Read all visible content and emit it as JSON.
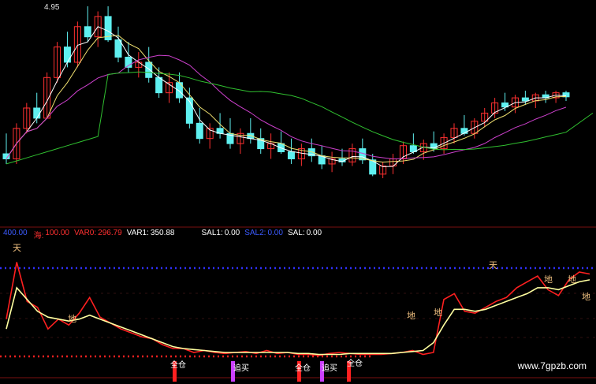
{
  "window": {
    "title": ""
  },
  "price_label": "4.95",
  "indicators": [
    {
      "name": "400.00",
      "value": "",
      "color": "#3b5bff"
    },
    {
      "name": "海:",
      "value": "100.00",
      "color": "#ff3030"
    },
    {
      "name": "VAR0:",
      "value": "296.79",
      "color": "#ff3030"
    },
    {
      "name": "VAR1:",
      "value": "350.88",
      "color": "#ffffff"
    },
    {
      "name": "SAL1:",
      "value": "0.00",
      "color": "#ffffff"
    },
    {
      "name": "SAL2:",
      "value": "0.00",
      "color": "#3b5bff"
    },
    {
      "name": "SAL:",
      "value": "0.00",
      "color": "#ffffff"
    }
  ],
  "signals": {
    "sky": "天",
    "ground": "地",
    "full": "全仓",
    "chase": "追买"
  },
  "watermark": "www.7gpzb.com",
  "colors": {
    "background": "#000000",
    "up_candle": "#ff3030",
    "down_candle": "#5ff0f0",
    "ma_short": "#ffffff",
    "ma_mid": "#f0e070",
    "ma_long": "#cc40cc",
    "ma_longer": "#30c030",
    "osc_red": "#ff2020",
    "osc_yellow": "#ffffa0",
    "level_blue": "#3030ff",
    "level_red": "#ff2020"
  },
  "chart_data": {
    "type": "candlestick",
    "candles": [
      [
        3.5,
        3.7,
        3.4,
        3.45
      ],
      [
        3.45,
        3.8,
        3.4,
        3.75
      ],
      [
        3.75,
        4.0,
        3.7,
        3.95
      ],
      [
        3.95,
        4.1,
        3.8,
        3.85
      ],
      [
        3.85,
        4.3,
        3.85,
        4.25
      ],
      [
        4.25,
        4.6,
        4.2,
        4.55
      ],
      [
        4.55,
        4.7,
        4.35,
        4.4
      ],
      [
        4.4,
        4.8,
        4.35,
        4.75
      ],
      [
        4.75,
        4.95,
        4.6,
        4.65
      ],
      [
        4.65,
        4.9,
        4.55,
        4.85
      ],
      [
        4.85,
        4.95,
        4.6,
        4.62
      ],
      [
        4.62,
        4.75,
        4.4,
        4.45
      ],
      [
        4.45,
        4.6,
        4.3,
        4.35
      ],
      [
        4.35,
        4.5,
        4.25,
        4.4
      ],
      [
        4.4,
        4.55,
        4.2,
        4.25
      ],
      [
        4.25,
        4.35,
        4.05,
        4.1
      ],
      [
        4.1,
        4.3,
        4.0,
        4.2
      ],
      [
        4.2,
        4.3,
        4.0,
        4.05
      ],
      [
        4.05,
        4.15,
        3.75,
        3.8
      ],
      [
        3.8,
        3.95,
        3.6,
        3.65
      ],
      [
        3.65,
        3.8,
        3.55,
        3.75
      ],
      [
        3.75,
        3.9,
        3.65,
        3.7
      ],
      [
        3.7,
        3.85,
        3.55,
        3.6
      ],
      [
        3.6,
        3.75,
        3.5,
        3.7
      ],
      [
        3.7,
        3.85,
        3.6,
        3.65
      ],
      [
        3.65,
        3.75,
        3.5,
        3.55
      ],
      [
        3.55,
        3.7,
        3.45,
        3.6
      ],
      [
        3.6,
        3.72,
        3.5,
        3.52
      ],
      [
        3.52,
        3.65,
        3.4,
        3.45
      ],
      [
        3.45,
        3.6,
        3.38,
        3.55
      ],
      [
        3.55,
        3.65,
        3.42,
        3.48
      ],
      [
        3.48,
        3.58,
        3.35,
        3.4
      ],
      [
        3.4,
        3.52,
        3.32,
        3.45
      ],
      [
        3.45,
        3.55,
        3.38,
        3.42
      ],
      [
        3.42,
        3.6,
        3.38,
        3.55
      ],
      [
        3.55,
        3.65,
        3.4,
        3.44
      ],
      [
        3.44,
        3.5,
        3.28,
        3.3
      ],
      [
        3.3,
        3.42,
        3.26,
        3.38
      ],
      [
        3.38,
        3.5,
        3.3,
        3.45
      ],
      [
        3.45,
        3.62,
        3.4,
        3.58
      ],
      [
        3.58,
        3.7,
        3.5,
        3.52
      ],
      [
        3.52,
        3.64,
        3.44,
        3.6
      ],
      [
        3.6,
        3.72,
        3.52,
        3.55
      ],
      [
        3.55,
        3.7,
        3.5,
        3.66
      ],
      [
        3.66,
        3.8,
        3.6,
        3.75
      ],
      [
        3.75,
        3.88,
        3.68,
        3.7
      ],
      [
        3.7,
        3.85,
        3.65,
        3.82
      ],
      [
        3.82,
        3.95,
        3.76,
        3.9
      ],
      [
        3.9,
        4.05,
        3.85,
        4.0
      ],
      [
        4.0,
        4.1,
        3.92,
        3.96
      ],
      [
        3.96,
        4.08,
        3.9,
        4.05
      ],
      [
        4.05,
        4.12,
        3.98,
        4.02
      ],
      [
        4.02,
        4.1,
        3.95,
        4.08
      ],
      [
        4.08,
        4.12,
        4.0,
        4.05
      ],
      [
        4.05,
        4.12,
        4.0,
        4.1
      ],
      [
        4.1,
        4.12,
        4.02,
        4.06
      ]
    ],
    "oscillator": {
      "red": [
        40,
        98,
        58,
        52,
        30,
        40,
        34,
        46,
        62,
        42,
        36,
        30,
        26,
        22,
        20,
        14,
        10,
        10,
        6,
        8,
        6,
        5,
        6,
        7,
        5,
        8,
        5,
        6,
        4,
        4,
        3,
        5,
        6,
        5,
        4,
        4,
        4,
        5,
        6,
        8,
        4,
        6,
        60,
        66,
        48,
        46,
        52,
        58,
        62,
        72,
        78,
        84,
        70,
        64,
        80,
        88,
        86
      ],
      "yellow": [
        30,
        72,
        60,
        48,
        42,
        40,
        38,
        40,
        44,
        40,
        36,
        32,
        28,
        24,
        20,
        16,
        12,
        10,
        9,
        8,
        7,
        6,
        6,
        6,
        6,
        6,
        6,
        6,
        5,
        5,
        4,
        4,
        4,
        5,
        5,
        5,
        5,
        5,
        6,
        7,
        8,
        16,
        34,
        50,
        50,
        48,
        50,
        54,
        58,
        62,
        66,
        72,
        72,
        70,
        74,
        78,
        80
      ],
      "upper_level": 92,
      "lower_level": 2
    }
  }
}
